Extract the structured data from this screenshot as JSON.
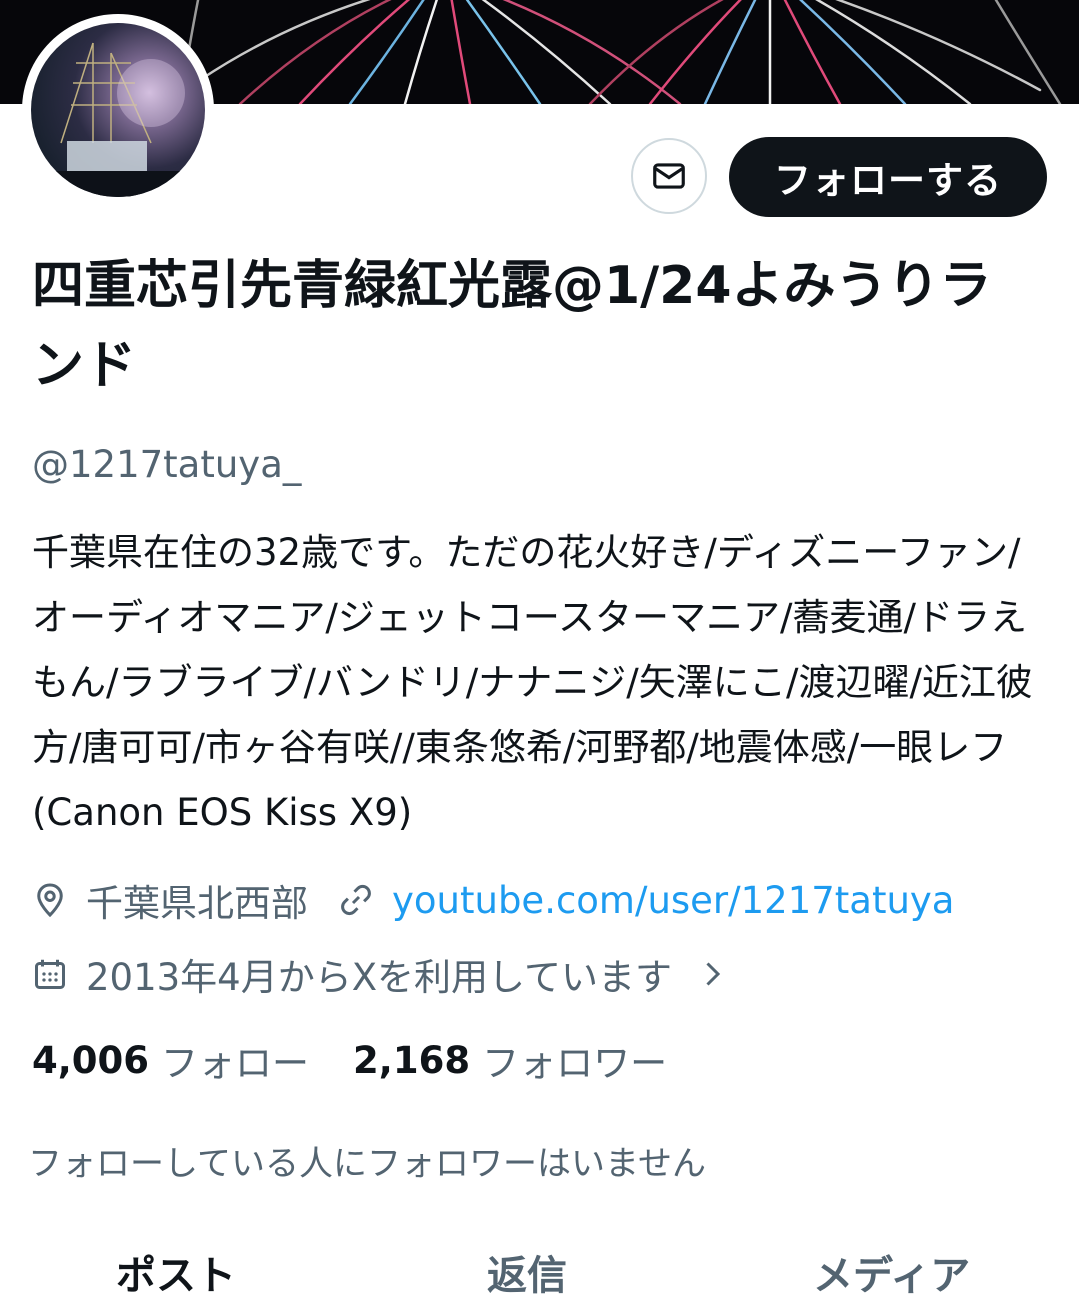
{
  "profile": {
    "display_name": "四重芯引先青緑紅光露@1/24よみうりランド",
    "handle": "@1217tatuya_",
    "bio": "千葉県在住の32歳です。ただの花火好き/ディズニーファン/オーディオマニア/ジェットコースターマニア/蕎麦通/ドラえもん/ラブライブ/バンドリ/ナナニジ/矢澤にこ/渡辺曜/近江彼方/唐可可/市ヶ谷有咲//東条悠希/河野都/地震体感/一眼レフ(Canon EOS Kiss X9)",
    "location": "千葉県北西部",
    "website": "youtube.com/user/1217tatuya",
    "joined": "2013年4月からXを利用しています"
  },
  "actions": {
    "follow_label": "フォローする",
    "message_icon": "envelope-icon"
  },
  "stats": {
    "following_count": "4,006",
    "following_label": "フォロー",
    "followers_count": "2,168",
    "followers_label": "フォロワー"
  },
  "mutual_note": "フォローしている人にフォロワーはいません",
  "tabs": [
    {
      "label": "ポスト",
      "active": true
    },
    {
      "label": "返信",
      "active": false
    },
    {
      "label": "メディア",
      "active": false
    }
  ],
  "icons": {
    "location": "location-pin-icon",
    "link": "link-icon",
    "calendar": "calendar-icon",
    "chevron": "chevron-right-icon"
  }
}
